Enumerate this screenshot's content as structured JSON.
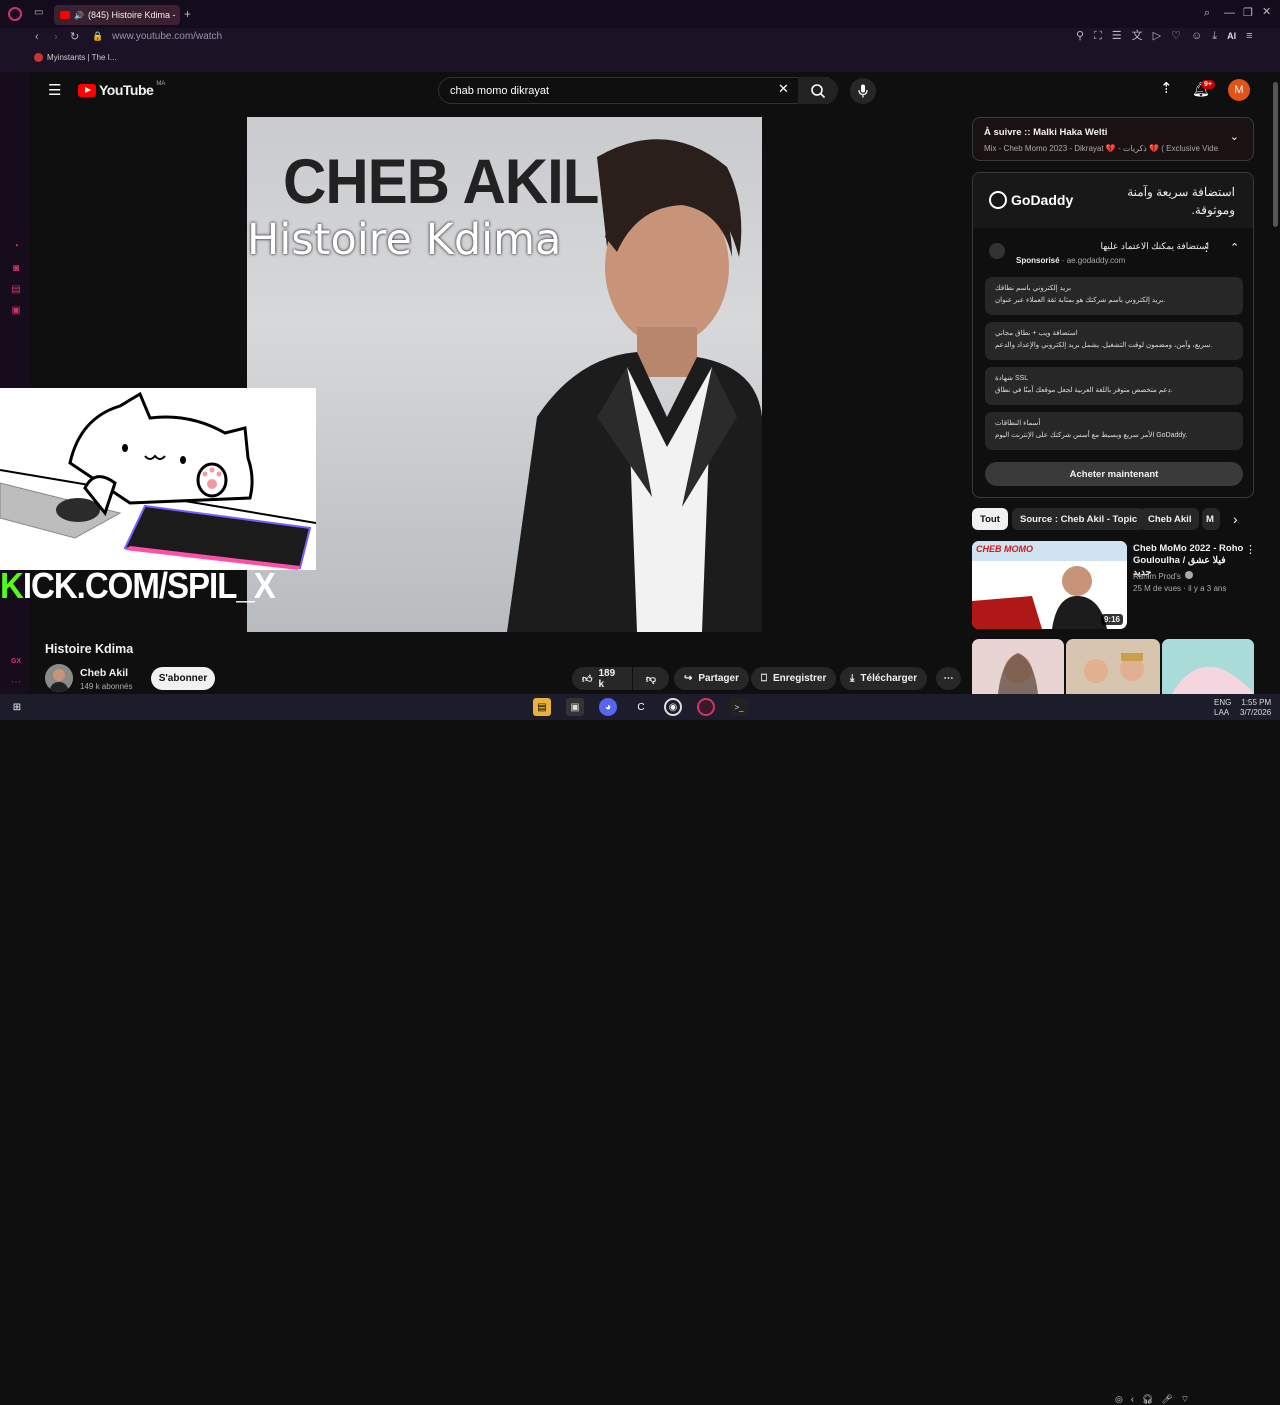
{
  "browser": {
    "tab_title": "(845) Histoire Kdima -",
    "url": "www.youtube.com/watch",
    "bookmark": "Myinstants | The I...",
    "ai_label": "AI"
  },
  "youtube": {
    "logo_text": "YouTube",
    "country": "MA",
    "search_query": "chab momo dikrayat",
    "notifications": "9+",
    "avatar_letter": "M"
  },
  "video": {
    "overlay_title": "CHEB AKIL",
    "overlay_subtitle": "Histoire Kdima",
    "kick_k": "K",
    "kick_rest": "ICK.COM/SPIL_X",
    "title": "Histoire Kdima"
  },
  "channel": {
    "name": "Cheb Akil",
    "subscribers": "149 k abonnés",
    "subscribe_label": "S'abonner"
  },
  "actions": {
    "likes": "189 k",
    "share": "Partager",
    "save": "Enregistrer",
    "download": "Télécharger"
  },
  "up_next": {
    "title": "À suivre :: Malki Haka Welti",
    "subtitle": "Mix - Cheb Momo 2023 - Dikrayat 💔 - ذكريات 💔 ( Exclusive Vide..."
  },
  "ad": {
    "brand": "GoDaddy",
    "tagline": "استضافة سريعة وآمنة وموثوقة.",
    "headline": "استضافة يمكنك الاعتماد عليها",
    "sponsored": "Sponsorisé",
    "domain": "ae.godaddy.com",
    "items": [
      {
        "title": "بريد إلكتروني باسم نطاقك",
        "desc": "بريد إلكتروني باسم شركتك هو بمثابة ثقة العملاء عبر عنوان."
      },
      {
        "title": "استضافة ويب + نطاق مجاني",
        "desc": "سريع، وآمن، ومضمون لوقت التشغيل. يشمل بريد إلكتروني والإعداد والدعم."
      },
      {
        "title": "شهادة SSL",
        "desc": "دعم متخصص متوفر باللغة العربية لجعل موقعك آمنًا في نطاق."
      },
      {
        "title": "أسماء النطاقات",
        "desc": "الأمر سريع وبسيط مع أسس شركتك على الإنترنت اليوم GoDaddy."
      }
    ],
    "cta": "Acheter maintenant"
  },
  "chips": [
    "Tout",
    "Source : Cheb Akil - Topic",
    "Cheb Akil",
    "M"
  ],
  "recommendation": {
    "title": "Cheb MoMo 2022 - Roho Gouloulha / فيلا عشق جديد",
    "channel": "Rahim Prod's",
    "meta": "25 M de vues · il y a 3 ans",
    "duration": "9:16",
    "thumb_text": "CHEB MOMO"
  },
  "taskbar": {
    "lang1": "ENG",
    "lang2": "LAA",
    "time": "1:55 PM",
    "date": "3/7/2026"
  },
  "colors": {
    "opera_red": "#d0346a",
    "yt_red": "#ff0000",
    "kick_green": "#53fc18"
  }
}
